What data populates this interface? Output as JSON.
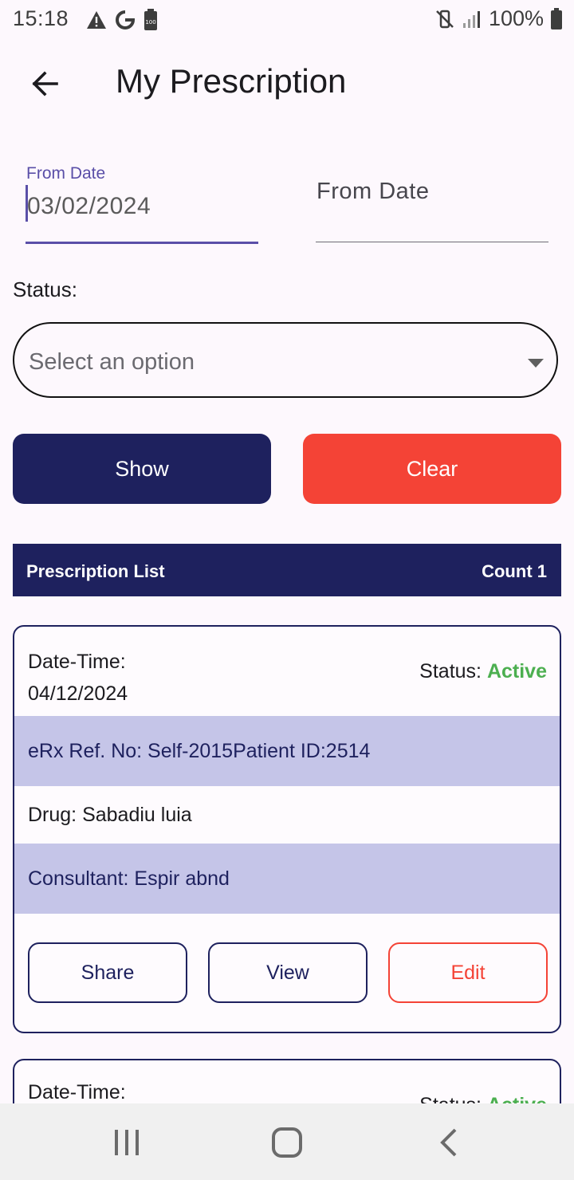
{
  "status_bar": {
    "time": "15:18",
    "left_icons": [
      "warning-icon",
      "google-icon",
      "battery-saver-icon"
    ],
    "right_icons": [
      "mute-vibrate-icon",
      "signal-icon",
      "battery-icon"
    ],
    "battery": "100%"
  },
  "appbar": {
    "title": "My Prescription",
    "back_icon": "arrow-left-icon"
  },
  "filters": {
    "from_date_1": {
      "label": "From Date",
      "value": "03/02/2024"
    },
    "from_date_2": {
      "label": "From Date"
    },
    "status_label": "Status:",
    "status_select": {
      "placeholder": "Select an option"
    },
    "show_label": "Show",
    "clear_label": "Clear"
  },
  "list_header": {
    "title": "Prescription List",
    "count": "Count 1"
  },
  "cards": [
    {
      "datetime_label": "Date-Time:",
      "datetime_value": "04/12/2024",
      "status_label": "Status:",
      "status_value": "Active",
      "ref": "eRx Ref. No: Self-2015Patient ID:2514",
      "drug": "Drug: Sabadiu luia",
      "consultant": "Consultant: Espir abnd",
      "share_label": "Share",
      "view_label": "View",
      "edit_label": "Edit"
    },
    {
      "datetime_label": "Date-Time:",
      "status_label": "Status:",
      "status_value": "Active"
    }
  ],
  "colors": {
    "primary": "#1e215e",
    "danger": "#f44336",
    "active": "#4caf50",
    "accent": "#5a4fa8",
    "row_shade": "#c5c5e8"
  },
  "nav_bar": {
    "icons": [
      "recents-icon",
      "home-icon",
      "back-icon"
    ]
  }
}
